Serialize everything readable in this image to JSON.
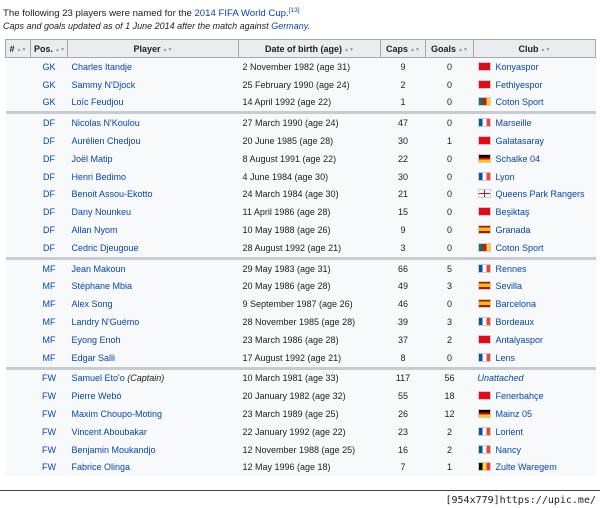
{
  "intro": {
    "line1_prefix": "The following 23 players were named for the ",
    "line1_link": "2014 FIFA World Cup",
    "line1_suffix": ".",
    "ref": "[13]",
    "line2_prefix": "Caps and goals updated as of 1 June 2014 after the match against ",
    "line2_link": "Germany",
    "line2_suffix": "."
  },
  "headers": [
    "#",
    "Pos.",
    "Player",
    "Date of birth (age)",
    "Caps",
    "Goals",
    "Club"
  ],
  "rows": [
    {
      "pos": "GK",
      "player": "Charles Itandje",
      "dob": "2 November 1982 (age 31)",
      "caps": "9",
      "goals": "0",
      "club": "Konyaspor",
      "flag": "turkey"
    },
    {
      "pos": "GK",
      "player": "Sammy N'Djock",
      "dob": "25 February 1990 (age 24)",
      "caps": "2",
      "goals": "0",
      "club": "Fethiyespor",
      "flag": "turkey"
    },
    {
      "pos": "GK",
      "player": "Loïc Feudjou",
      "dob": "14 April 1992 (age 22)",
      "caps": "1",
      "goals": "0",
      "club": "Coton Sport",
      "flag": "cameroon"
    },
    {
      "pos": "DF",
      "player": "Nicolas N'Koulou",
      "dob": "27 March 1990 (age 24)",
      "caps": "47",
      "goals": "0",
      "club": "Marseille",
      "flag": "france",
      "gap": true
    },
    {
      "pos": "DF",
      "player": "Aurélien Chedjou",
      "dob": "20 June 1985 (age 28)",
      "caps": "30",
      "goals": "1",
      "club": "Galatasaray",
      "flag": "turkey"
    },
    {
      "pos": "DF",
      "player": "Joël Matip",
      "dob": "8 August 1991 (age 22)",
      "caps": "22",
      "goals": "0",
      "club": "Schalke 04",
      "flag": "germany"
    },
    {
      "pos": "DF",
      "player": "Henri Bedimo",
      "dob": "4 June 1984 (age 30)",
      "caps": "30",
      "goals": "0",
      "club": "Lyon",
      "flag": "france"
    },
    {
      "pos": "DF",
      "player": "Benoit Assou-Ekotto",
      "dob": "24 March 1984 (age 30)",
      "caps": "21",
      "goals": "0",
      "club": "Queens Park Rangers",
      "flag": "england"
    },
    {
      "pos": "DF",
      "player": "Dany Nounkeu",
      "dob": "11 April 1986 (age 28)",
      "caps": "15",
      "goals": "0",
      "club": "Beşiktaş",
      "flag": "turkey"
    },
    {
      "pos": "DF",
      "player": "Allan Nyom",
      "dob": "10 May 1988 (age 26)",
      "caps": "9",
      "goals": "0",
      "club": "Granada",
      "flag": "spain"
    },
    {
      "pos": "DF",
      "player": "Cedric Djeugoue",
      "dob": "28 August 1992 (age 21)",
      "caps": "3",
      "goals": "0",
      "club": "Coton Sport",
      "flag": "cameroon"
    },
    {
      "pos": "MF",
      "player": "Jean Makoun",
      "dob": "29 May 1983 (age 31)",
      "caps": "66",
      "goals": "5",
      "club": "Rennes",
      "flag": "france",
      "gap": true
    },
    {
      "pos": "MF",
      "player": "Stéphane Mbia",
      "dob": "20 May 1986 (age 28)",
      "caps": "49",
      "goals": "3",
      "club": "Sevilla",
      "flag": "spain"
    },
    {
      "pos": "MF",
      "player": "Alex Song",
      "dob": "9 September 1987 (age 26)",
      "caps": "46",
      "goals": "0",
      "club": "Barcelona",
      "flag": "spain"
    },
    {
      "pos": "MF",
      "player": "Landry N'Guémo",
      "dob": "28 November 1985 (age 28)",
      "caps": "39",
      "goals": "3",
      "club": "Bordeaux",
      "flag": "france"
    },
    {
      "pos": "MF",
      "player": "Eyong Enoh",
      "dob": "23 March 1986 (age 28)",
      "caps": "37",
      "goals": "2",
      "club": "Antalyaspor",
      "flag": "turkey"
    },
    {
      "pos": "MF",
      "player": "Edgar Salli",
      "dob": "17 August 1992 (age 21)",
      "caps": "8",
      "goals": "0",
      "club": "Lens",
      "flag": "france"
    },
    {
      "pos": "FW",
      "player": "Samuel Eto'o",
      "captain": "(Captain)",
      "dob": "10 March 1981 (age 33)",
      "caps": "117",
      "goals": "56",
      "club": "Unattached",
      "flag": "",
      "gap": true
    },
    {
      "pos": "FW",
      "player": "Pierre Webó",
      "dob": "20 January 1982 (age 32)",
      "caps": "55",
      "goals": "18",
      "club": "Fenerbahçe",
      "flag": "turkey"
    },
    {
      "pos": "FW",
      "player": "Maxim Choupo-Moting",
      "dob": "23 March 1989 (age 25)",
      "caps": "26",
      "goals": "12",
      "club": "Mainz 05",
      "flag": "germany"
    },
    {
      "pos": "FW",
      "player": "Vincent Aboubakar",
      "dob": "22 January 1992 (age 22)",
      "caps": "23",
      "goals": "2",
      "club": "Lorient",
      "flag": "france"
    },
    {
      "pos": "FW",
      "player": "Benjamin Moukandjo",
      "dob": "12 November 1988 (age 25)",
      "caps": "16",
      "goals": "2",
      "club": "Nancy",
      "flag": "france"
    },
    {
      "pos": "FW",
      "player": "Fabrice Olinga",
      "dob": "12 May 1996 (age 18)",
      "caps": "7",
      "goals": "1",
      "club": "Zulte Waregem",
      "flag": "belgium"
    }
  ],
  "colors": {
    "link": "#0645ad",
    "header_bg": "#eaecf0",
    "row_bg": "#f8f9fa",
    "group_separator": "#c8ccd1"
  },
  "watermark": "[954x779]https://upic.me/"
}
